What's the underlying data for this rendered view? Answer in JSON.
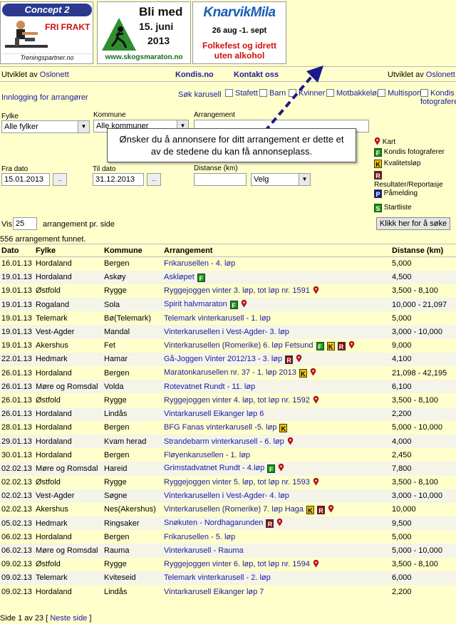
{
  "banners": {
    "concept": {
      "logo": "Concept 2",
      "promo": "FRI FRAKT",
      "site": "Treningspartner.no"
    },
    "skog": {
      "line1": "Bli med",
      "line2": "15. juni",
      "line3": "2013",
      "brand": "Skogsmaraton",
      "url": "www.skogsmaraton.no"
    },
    "knarvik": {
      "title": "KnarvikMila",
      "dates": "26 aug -1. sept",
      "slogan1": "Folkefest og idrett",
      "slogan2": "uten alkohol"
    }
  },
  "nav": {
    "left_prefix": "Utviklet av ",
    "left_link": "Oslonett",
    "kondis": "Kondis.no",
    "kontakt": "Kontakt oss",
    "right_prefix": "Utviklet av ",
    "right_link": "Oslonett"
  },
  "form": {
    "login": "Innlogging for arrangører",
    "sok_karusell": "Søk karusell",
    "checkboxes": [
      "Stafett",
      "Barn",
      "Kvinner",
      "Motbakkeløp",
      "Multisport",
      "Kondis fotograferer"
    ],
    "fylke_label": "Fylke",
    "fylke_value": "Alle fylker",
    "kommune_label": "Kommune",
    "kommune_value": "Alle kommuner",
    "arrangement_label": "Arrangement",
    "fra_label": "Fra dato",
    "fra_value": "15.01.2013",
    "til_label": "Til dato",
    "til_value": "31.12.2013",
    "distanse_label": "Distanse (km)",
    "velg": "Velg",
    "vis_label": "Vis",
    "vis_value": "25",
    "per_side": "arrangement pr. side",
    "search_button": "Klikk her for å søke",
    "date_btn": ".."
  },
  "legend": {
    "kart": "Kart",
    "kondis_foto": "Kondis fotograferer",
    "kvalitet": "Kvalitetsløp",
    "resultater": "Resultater/Reportasje",
    "pamelding": "Påmelding",
    "startliste": "Startliste"
  },
  "callout": {
    "line1": "Ønsker du å annonsere for ditt arrangement er dette et",
    "line2": "av de stedene du kan få annonseplass."
  },
  "results": {
    "count": "556 arrangement funnet.",
    "headers": [
      "Dato",
      "Fylke",
      "Kommune",
      "Arrangement",
      "Distanse (km)"
    ],
    "rows": [
      {
        "d": "16.01.13",
        "f": "Hordaland",
        "k": "Bergen",
        "a": "Frikarusellen - 4. løp",
        "b": [],
        "dist": "5,000"
      },
      {
        "d": "19.01.13",
        "f": "Hordaland",
        "k": "Askøy",
        "a": "Askløpet",
        "b": [
          "F"
        ],
        "dist": "4,500"
      },
      {
        "d": "19.01.13",
        "f": "Østfold",
        "k": "Rygge",
        "a": "Ryggejoggen vinter 3. løp, tot løp nr. 1591",
        "b": [
          "pin"
        ],
        "dist": "3,500 - 8,100"
      },
      {
        "d": "19.01.13",
        "f": "Rogaland",
        "k": "Sola",
        "a": "Spirit halvmaraton",
        "b": [
          "F",
          "pin"
        ],
        "dist": "10,000 - 21,097"
      },
      {
        "d": "19.01.13",
        "f": "Telemark",
        "k": "Bø(Telemark)",
        "a": "Telemark vinterkarusell - 1. løp",
        "b": [],
        "dist": "5,000"
      },
      {
        "d": "19.01.13",
        "f": "Vest-Agder",
        "k": "Mandal",
        "a": "Vinterkarusellen i Vest-Agder- 3. løp",
        "b": [],
        "dist": "3,000 - 10,000"
      },
      {
        "d": "19.01.13",
        "f": "Akershus",
        "k": "Fet",
        "a": "Vinterkarusellen (Romerike) 6. løp Fetsund",
        "b": [
          "F",
          "K",
          "R",
          "pin"
        ],
        "dist": "9,000"
      },
      {
        "d": "22.01.13",
        "f": "Hedmark",
        "k": "Hamar",
        "a": "Gå-Joggen Vinter 2012/13 - 3. løp",
        "b": [
          "R",
          "pin"
        ],
        "dist": "4,100"
      },
      {
        "d": "26.01.13",
        "f": "Hordaland",
        "k": "Bergen",
        "a": "Maratonkarusellen nr. 37 - 1. løp 2013",
        "b": [
          "K",
          "pin"
        ],
        "dist": "21,098 - 42,195"
      },
      {
        "d": "26.01.13",
        "f": "Møre og Romsdal",
        "k": "Volda",
        "a": "Rotevatnet Rundt - 11. løp",
        "b": [],
        "dist": "6,100"
      },
      {
        "d": "26.01.13",
        "f": "Østfold",
        "k": "Rygge",
        "a": "Ryggejoggen vinter 4. løp, tot løp nr. 1592",
        "b": [
          "pin"
        ],
        "dist": "3,500 - 8,100"
      },
      {
        "d": "26.01.13",
        "f": "Hordaland",
        "k": "Lindås",
        "a": "Vintarkarusell Eikanger løp 6",
        "b": [],
        "dist": "2,200"
      },
      {
        "d": "28.01.13",
        "f": "Hordaland",
        "k": "Bergen",
        "a": "BFG Fanas vinterkarusell -5. løp",
        "b": [
          "K"
        ],
        "dist": "5,000 - 10,000"
      },
      {
        "d": "29.01.13",
        "f": "Hordaland",
        "k": "Kvam herad",
        "a": "Strandebarm vinterkarusell - 6. løp",
        "b": [
          "pin"
        ],
        "dist": "4,000"
      },
      {
        "d": "30.01.13",
        "f": "Hordaland",
        "k": "Bergen",
        "a": "Fløyenkarusellen - 1. løp",
        "b": [],
        "dist": "2,450"
      },
      {
        "d": "02.02.13",
        "f": "Møre og Romsdal",
        "k": "Hareid",
        "a": "Grimstadvatnet Rundt - 4.løp",
        "b": [
          "F",
          "pin"
        ],
        "dist": "7,800"
      },
      {
        "d": "02.02.13",
        "f": "Østfold",
        "k": "Rygge",
        "a": "Ryggejoggen vinter 5. løp, tot løp nr. 1593",
        "b": [
          "pin"
        ],
        "dist": "3,500 - 8,100"
      },
      {
        "d": "02.02.13",
        "f": "Vest-Agder",
        "k": "Søgne",
        "a": "Vinterkarusellen i Vest-Agder- 4. løp",
        "b": [],
        "dist": "3,000 - 10,000"
      },
      {
        "d": "02.02.13",
        "f": "Akershus",
        "k": "Nes(Akershus)",
        "a": "Vinterkarusellen (Romerike) 7. løp Haga",
        "b": [
          "K",
          "R",
          "pin"
        ],
        "dist": "10,000"
      },
      {
        "d": "05.02.13",
        "f": "Hedmark",
        "k": "Ringsaker",
        "a": "Snøkuten - Nordhagarunden",
        "b": [
          "R",
          "pin"
        ],
        "dist": "9,500"
      },
      {
        "d": "06.02.13",
        "f": "Hordaland",
        "k": "Bergen",
        "a": "Frikarusellen - 5. løp",
        "b": [],
        "dist": "5,000"
      },
      {
        "d": "06.02.13",
        "f": "Møre og Romsdal",
        "k": "Rauma",
        "a": "Vinterkarusell - Rauma",
        "b": [],
        "dist": "5,000 - 10,000"
      },
      {
        "d": "09.02.13",
        "f": "Østfold",
        "k": "Rygge",
        "a": "Ryggejoggen vinter 6. løp, tot løp nr. 1594",
        "b": [
          "pin"
        ],
        "dist": "3,500 - 8,100"
      },
      {
        "d": "09.02.13",
        "f": "Telemark",
        "k": "Kviteseid",
        "a": "Telemark vinterkarusell - 2. løp",
        "b": [],
        "dist": "6,000"
      },
      {
        "d": "09.02.13",
        "f": "Hordaland",
        "k": "Lindås",
        "a": "Vintarkarusell Eikanger løp 7",
        "b": [],
        "dist": "2,200"
      }
    ]
  },
  "pager": {
    "text": "Side 1 av 23 [ ",
    "next": "Neste side",
    "close": " ]"
  },
  "colors": {
    "background": "#ffffcc",
    "link": "#1a1aa6",
    "badge_F": "#0a9a0a",
    "badge_K": "#f2c200",
    "badge_R": "#8a1010",
    "pin": "#d01010"
  }
}
